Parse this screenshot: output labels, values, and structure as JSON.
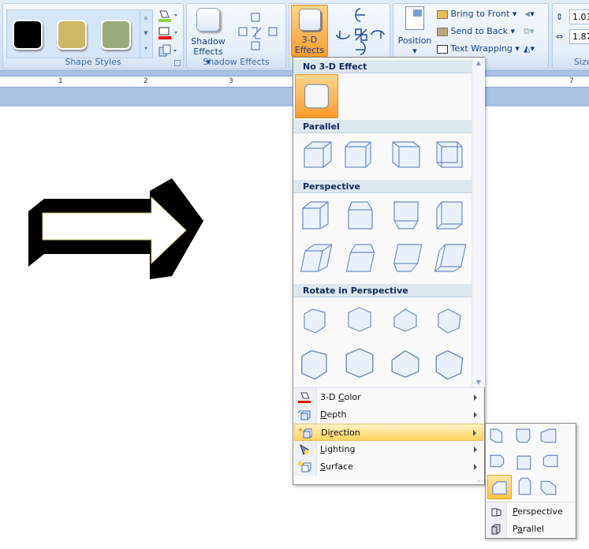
{
  "ribbon": {
    "shape_styles": {
      "label": "Shape Styles",
      "swatches": [
        "#000000",
        "#cdb865",
        "#9aab7c"
      ],
      "fill_color": "#92d050",
      "outline_color": "#ff0000"
    },
    "shadow_effects": {
      "button_line1": "Shadow",
      "button_line2": "Effects",
      "label": "Shadow Effects"
    },
    "three_d": {
      "button_line1": "3-D",
      "button_line2": "Effects"
    },
    "arrange": {
      "position": "Position",
      "bring_to_front": "Bring to Front",
      "send_to_back": "Send to Back",
      "text_wrapping": "Text Wrapping"
    },
    "size": {
      "height": "1.03",
      "width": "1.87",
      "label": "Size"
    }
  },
  "ruler": {
    "ticks": [
      "1",
      "2",
      "3",
      "7"
    ]
  },
  "menu": {
    "sections": [
      {
        "title": "No 3-D Effect",
        "items": [
          "no-3d"
        ]
      },
      {
        "title": "Parallel",
        "items": [
          "parallel-1",
          "parallel-2",
          "parallel-3",
          "parallel-4"
        ]
      },
      {
        "title": "Perspective",
        "items": [
          "perspective-1",
          "perspective-2",
          "perspective-3",
          "perspective-4",
          "perspective-5",
          "perspective-6",
          "perspective-7",
          "perspective-8"
        ]
      },
      {
        "title": "Rotate in Perspective",
        "items": [
          "rotate-1",
          "rotate-2",
          "rotate-3",
          "rotate-4",
          "rotate-5",
          "rotate-6",
          "rotate-7",
          "rotate-8"
        ]
      }
    ],
    "commands": [
      {
        "pre": "3-D ",
        "u": "C",
        "post": "olor",
        "icon": "paint-bucket-icon"
      },
      {
        "pre": "",
        "u": "D",
        "post": "epth",
        "icon": "depth-icon"
      },
      {
        "pre": "Di",
        "u": "r",
        "post": "ection",
        "icon": "direction-icon",
        "active": true
      },
      {
        "pre": "",
        "u": "L",
        "post": "ighting",
        "icon": "lighting-icon"
      },
      {
        "pre": "",
        "u": "S",
        "post": "urface",
        "icon": "surface-icon"
      }
    ]
  },
  "submenu": {
    "directions": [
      "top-left",
      "top",
      "top-right",
      "left",
      "none",
      "right",
      "bottom-left",
      "bottom",
      "bottom-right"
    ],
    "selected": "bottom-left",
    "perspective": {
      "u": "P",
      "post": "erspective"
    },
    "parallel": {
      "pre": "P",
      "u": "a",
      "post": "rallel"
    }
  }
}
